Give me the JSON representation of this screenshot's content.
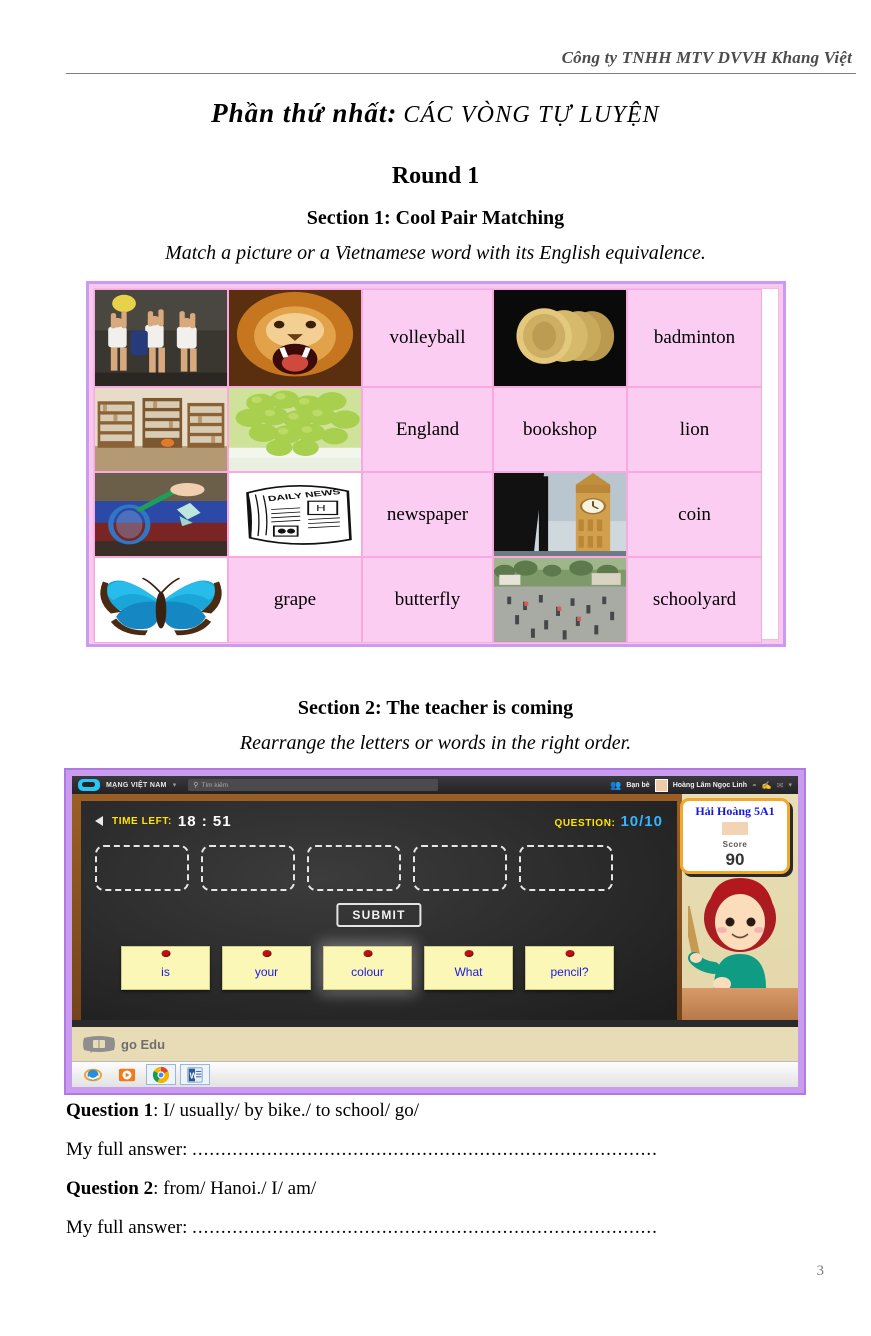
{
  "header": {
    "publisher": "Công ty TNHH MTV DVVH Khang Việt"
  },
  "title": {
    "part_bold": "Phần thứ nhất:",
    "part_rest": "CÁC VÒNG TỰ LUYỆN"
  },
  "round": "Round 1",
  "section1": {
    "title": "Section 1: Cool Pair Matching",
    "instruction": "Match a picture or a Vietnamese word with its English equivalence.",
    "grid": {
      "columns": 5,
      "rows": 4,
      "cells": [
        {
          "type": "picture",
          "name": "volleyball-photo"
        },
        {
          "type": "picture",
          "name": "lion-photo"
        },
        {
          "type": "word",
          "text": "volleyball"
        },
        {
          "type": "picture",
          "name": "coins-photo"
        },
        {
          "type": "word",
          "text": "badminton"
        },
        {
          "type": "picture",
          "name": "bookshop-photo"
        },
        {
          "type": "picture",
          "name": "grapes-photo"
        },
        {
          "type": "word",
          "text": "England"
        },
        {
          "type": "word",
          "text": "bookshop"
        },
        {
          "type": "word",
          "text": "lion"
        },
        {
          "type": "picture",
          "name": "badminton-photo"
        },
        {
          "type": "picture",
          "name": "newspaper-photo"
        },
        {
          "type": "word",
          "text": "newspaper"
        },
        {
          "type": "picture",
          "name": "bigben-photo"
        },
        {
          "type": "word",
          "text": "coin"
        },
        {
          "type": "picture",
          "name": "butterfly-photo"
        },
        {
          "type": "word",
          "text": "grape"
        },
        {
          "type": "word",
          "text": "butterfly"
        },
        {
          "type": "picture",
          "name": "schoolyard-photo"
        },
        {
          "type": "word",
          "text": "schoolyard"
        }
      ]
    }
  },
  "section2": {
    "title": "Section 2: The teacher is coming",
    "instruction": "Rearrange the letters or words in the right order.",
    "game": {
      "topbar": {
        "brand": "MẠNG VIỆT NAM",
        "brand_caret": "▾",
        "search_placeholder": "Tìm kiếm",
        "search_icon": "search-icon",
        "friends_label": "Bạn bè",
        "user_name": "Hoàng Lâm Ngọc Linh",
        "right_caret": "▾"
      },
      "board": {
        "time_label": "TIME LEFT:",
        "time_value": "18 : 51",
        "question_label": "QUESTION:",
        "question_value": "10/10",
        "submit_label": "SUBMIT",
        "slot_count": 5,
        "tiles": [
          {
            "word": "is",
            "highlighted": false
          },
          {
            "word": "your",
            "highlighted": false
          },
          {
            "word": "colour",
            "highlighted": true
          },
          {
            "word": "What",
            "highlighted": false
          },
          {
            "word": "pencil?",
            "highlighted": false
          }
        ]
      },
      "scorecard": {
        "player": "Hải Hoàng 5A1",
        "score_label": "Score",
        "score_value": "90"
      },
      "branding": {
        "logo_text": "go Edu"
      },
      "taskbar": [
        {
          "name": "internet-explorer-icon"
        },
        {
          "name": "media-player-icon"
        },
        {
          "name": "chrome-icon"
        },
        {
          "name": "word-icon"
        }
      ]
    }
  },
  "questions": [
    {
      "label": "Question 1",
      "prompt": ": I/ usually/ by bike./ to school/ go/",
      "answer_label": "My full answer: ",
      "answer_dots": "................................................................................."
    },
    {
      "label": "Question 2",
      "prompt": ": from/ Hanoi./ I/ am/",
      "answer_label": "My full answer: ",
      "answer_dots": "................................................................................."
    }
  ],
  "page_number": "3",
  "colors": {
    "grid_outer_border": "#cc9aee",
    "grid_pink_cell": "#fbcdf2",
    "game_border": "#c99cf0",
    "accent_yellow": "#ffe500",
    "accent_blue": "#33b5ff"
  }
}
